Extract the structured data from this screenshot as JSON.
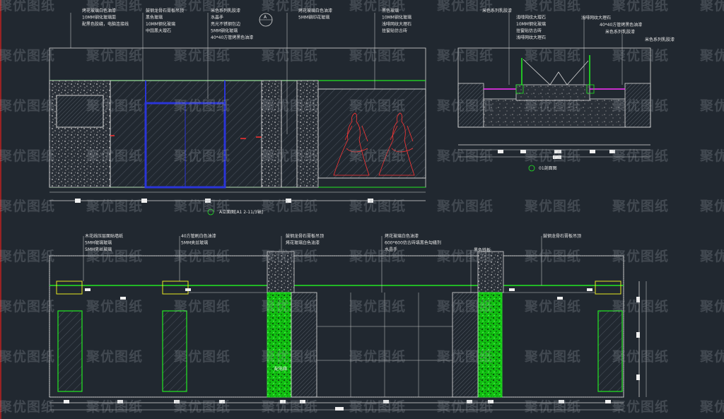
{
  "watermark": "聚优图纸",
  "colors": {
    "background": "#212830",
    "line_white": "#e0e0e0",
    "green": "#22e822",
    "bright_green": "#33ff33",
    "blue": "#2a35d8",
    "red": "#ff3030",
    "magenta": "#ff30ff",
    "yellow": "#e8e820"
  },
  "elevation_a": {
    "title": "A立面图[A1 2-11/3轴]",
    "annotation_groups": [
      [
        "烤花玻璃白色油漆",
        "10MM钢化玻璃面",
        "配黑色胶缝，电脑连接线"
      ],
      [
        "鼓钢龙骨石膏板吊顶",
        "黑色玻璃",
        "10MM钢化玻璃",
        "中国黑大理石"
      ],
      [
        "米色系列乳胶漆",
        "水晶手",
        "亮光不锈钢包边",
        "5MM钢化玻璃",
        "40*40方管烤黑色油漆"
      ],
      [
        "烤花玻璃白色油漆",
        "5MM钢印花玻璃"
      ],
      [
        "黑色玻璃",
        "10MM钢化玻璃",
        "浅啡网纹大理石",
        "挂窗贴仿古砖"
      ]
    ]
  },
  "section_top": {
    "title": "01剖面图",
    "annotation_left": [
      "米色系列乳胶漆",
      "浅啡网纹大理石",
      "10MM钢化玻璃",
      "挂窗贴仿古砖",
      "浅啡网纹大理石"
    ],
    "annotation_right": [
      "浅啡网纹大理石",
      "40*40方管烤黑色油漆",
      "米色系列乳胶漆",
      "米色系列乳胶漆"
    ]
  },
  "section_marker": "A",
  "elevation_b": {
    "annotation_groups": [
      [
        "木花线压层面贴墙纸",
        "5MM玻璃玻璃",
        "5MM夹丝玻璃"
      ],
      [
        "40方管刷白色油漆",
        "5MM夹丝玻璃"
      ],
      [
        "鼓钢龙骨石膏板吊顶",
        "烤花玻璃白色油漆"
      ],
      [
        "烤花玻璃白色油漆",
        "600*600仿古砖填黑色勾缝剂",
        "水晶手"
      ],
      [
        "黑色铁板"
      ],
      [
        "鼓钢龙骨石膏板吊顶"
      ]
    ],
    "door_label": "配电箱"
  }
}
